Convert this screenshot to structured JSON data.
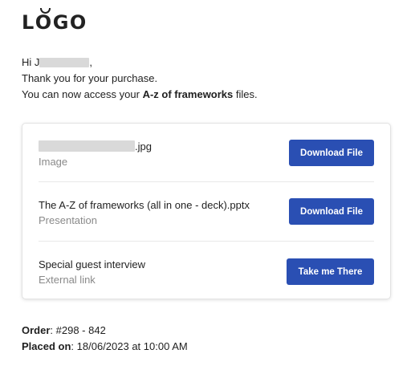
{
  "logo": {
    "text": "LOGO"
  },
  "greeting": {
    "hi": "Hi",
    "initial": "J",
    "thanks": "Thank you for your purchase.",
    "access_prefix": "You can now access your",
    "product": "A-z of frameworks",
    "access_suffix": "files."
  },
  "files": [
    {
      "name_suffix": ".jpg",
      "type": "Image",
      "button": "Download File"
    },
    {
      "name": "The A-Z of frameworks (all in one - deck).pptx",
      "type": "Presentation",
      "button": "Download File"
    },
    {
      "name": "Special guest interview",
      "type": "External link",
      "button": "Take me There"
    }
  ],
  "order": {
    "order_label": "Order",
    "order_value": "#298 - 842",
    "placed_label": "Placed on",
    "placed_value": "18/06/2023 at 10:00 AM"
  },
  "colors": {
    "button_bg": "#2a4fb3",
    "muted_text": "#8a8a8a"
  }
}
